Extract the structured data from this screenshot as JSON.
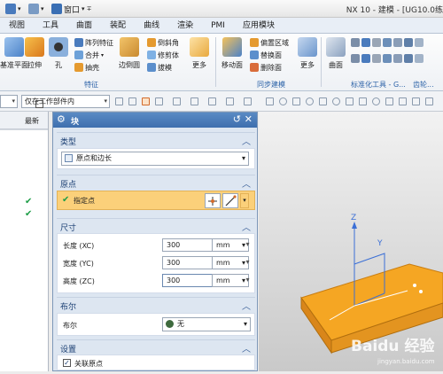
{
  "titlebar": {
    "window_label": "窗口",
    "app_title": "NX 10 - 建模 - [UG10.0练"
  },
  "menubar": {
    "items": [
      "视图",
      "工具",
      "曲面",
      "装配",
      "曲线",
      "渲染",
      "PMI",
      "应用模块"
    ]
  },
  "ribbon": {
    "datum_plane_label": "基准平面",
    "extrude_label": "拉伸",
    "hole_label": "孔",
    "pattern_feature_label": "阵列特征",
    "unite_label": "合并",
    "shell_label": "抽壳",
    "edge_blend_label": "边倒圆",
    "chamfer_label": "倒斜角",
    "trim_body_label": "修剪体",
    "draft_label": "拔模",
    "more_label_1": "更多",
    "move_face_label": "移动面",
    "offset_region_label": "偏置区域",
    "replace_face_label": "替换面",
    "delete_face_label": "删除面",
    "more_label_2": "更多",
    "surface_label": "曲面",
    "group_feature": "特征",
    "group_sync": "同步建模",
    "group_std": "标准化工具 - G...",
    "group_gear": "齿轮..."
  },
  "cmdbar": {
    "filter_value": "仅在工作部件内"
  },
  "navigator": {
    "column_label": "最新"
  },
  "dialog": {
    "title": "块",
    "type_section": "类型",
    "type_value": "原点和边长",
    "origin_section": "原点",
    "specify_point_label": "指定点",
    "size_section": "尺寸",
    "length_label": "长度 (XC)",
    "width_label": "宽度 (YC)",
    "height_label": "高度 (ZC)",
    "length_value": "300",
    "width_value": "300",
    "height_value": "300",
    "unit": "mm",
    "boolean_section": "布尔",
    "boolean_label": "布尔",
    "boolean_value": "无",
    "settings_section": "设置",
    "associative_origin_label": "关联原点"
  },
  "viewport": {
    "axis_z_label": "Z",
    "axis_y_label": "Y",
    "watermark": "Baidu 经验",
    "watermark_url": "jingyan.baidu.com"
  },
  "colors": {
    "dialog_title": "#4a7bbd",
    "highlight": "#fbd07a",
    "block_face": "#f5a623",
    "axis": "#3b6fd6",
    "check": "#1e9e48"
  }
}
